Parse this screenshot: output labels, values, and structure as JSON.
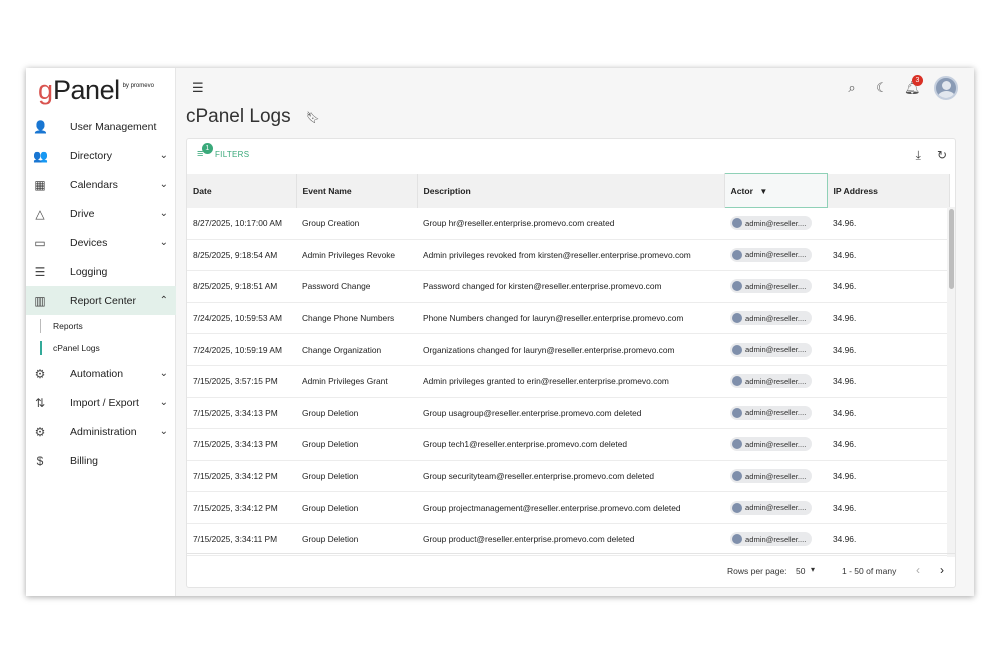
{
  "logo": {
    "g": "g",
    "rest": "Panel",
    "by": "by promevo"
  },
  "sidebar": {
    "items": [
      {
        "label": "User Management",
        "icon": "person-icon",
        "glyph": "👤",
        "chevron": ""
      },
      {
        "label": "Directory",
        "icon": "people-icon",
        "glyph": "👥",
        "chevron": "⌄"
      },
      {
        "label": "Calendars",
        "icon": "calendar-icon",
        "glyph": "▦",
        "chevron": "⌄"
      },
      {
        "label": "Drive",
        "icon": "drive-icon",
        "glyph": "△",
        "chevron": "⌄"
      },
      {
        "label": "Devices",
        "icon": "devices-icon",
        "glyph": "▭",
        "chevron": "⌄"
      },
      {
        "label": "Logging",
        "icon": "list-icon",
        "glyph": "☰",
        "chevron": ""
      },
      {
        "label": "Report Center",
        "icon": "report-icon",
        "glyph": "▥",
        "chevron": "⌃"
      },
      {
        "label": "Automation",
        "icon": "automation-icon",
        "glyph": "⚙",
        "chevron": "⌄"
      },
      {
        "label": "Import / Export",
        "icon": "import-export-icon",
        "glyph": "⇅",
        "chevron": "⌄"
      },
      {
        "label": "Administration",
        "icon": "admin-icon",
        "glyph": "⚙",
        "chevron": "⌄"
      },
      {
        "label": "Billing",
        "icon": "dollar-icon",
        "glyph": "$",
        "chevron": ""
      }
    ],
    "sub_items": [
      {
        "label": "Reports"
      },
      {
        "label": "cPanel Logs"
      }
    ]
  },
  "header": {
    "title": "cPanel Logs",
    "notification_count": "3"
  },
  "toolbar": {
    "filters_label": "FILTERS",
    "filter_count": "1"
  },
  "table": {
    "columns": [
      "Date",
      "Event Name",
      "Description",
      "Actor",
      "IP Address"
    ],
    "rows": [
      {
        "date": "8/27/2025, 10:17:00 AM",
        "event": "Group Creation",
        "desc": "Group hr@reseller.enterprise.promevo.com created",
        "actor": "admin@reseller....",
        "ip": "34.96."
      },
      {
        "date": "8/25/2025, 9:18:54 AM",
        "event": "Admin Privileges Revoke",
        "desc": "Admin privileges revoked from kirsten@reseller.enterprise.promevo.com",
        "actor": "admin@reseller....",
        "ip": "34.96."
      },
      {
        "date": "8/25/2025, 9:18:51 AM",
        "event": "Password Change",
        "desc": "Password changed for kirsten@reseller.enterprise.promevo.com",
        "actor": "admin@reseller....",
        "ip": "34.96."
      },
      {
        "date": "7/24/2025, 10:59:53 AM",
        "event": "Change Phone Numbers",
        "desc": "Phone Numbers changed for lauryn@reseller.enterprise.promevo.com",
        "actor": "admin@reseller....",
        "ip": "34.96."
      },
      {
        "date": "7/24/2025, 10:59:19 AM",
        "event": "Change Organization",
        "desc": "Organizations changed for lauryn@reseller.enterprise.promevo.com",
        "actor": "admin@reseller....",
        "ip": "34.96."
      },
      {
        "date": "7/15/2025, 3:57:15 PM",
        "event": "Admin Privileges Grant",
        "desc": "Admin privileges granted to erin@reseller.enterprise.promevo.com",
        "actor": "admin@reseller....",
        "ip": "34.96."
      },
      {
        "date": "7/15/2025, 3:34:13 PM",
        "event": "Group Deletion",
        "desc": "Group usagroup@reseller.enterprise.promevo.com deleted",
        "actor": "admin@reseller....",
        "ip": "34.96."
      },
      {
        "date": "7/15/2025, 3:34:13 PM",
        "event": "Group Deletion",
        "desc": "Group tech1@reseller.enterprise.promevo.com deleted",
        "actor": "admin@reseller....",
        "ip": "34.96."
      },
      {
        "date": "7/15/2025, 3:34:12 PM",
        "event": "Group Deletion",
        "desc": "Group securityteam@reseller.enterprise.promevo.com deleted",
        "actor": "admin@reseller....",
        "ip": "34.96."
      },
      {
        "date": "7/15/2025, 3:34:12 PM",
        "event": "Group Deletion",
        "desc": "Group projectmanagement@reseller.enterprise.promevo.com deleted",
        "actor": "admin@reseller....",
        "ip": "34.96."
      },
      {
        "date": "7/15/2025, 3:34:11 PM",
        "event": "Group Deletion",
        "desc": "Group product@reseller.enterprise.promevo.com deleted",
        "actor": "admin@reseller....",
        "ip": "34.96."
      }
    ]
  },
  "footer": {
    "rows_per_page_label": "Rows per page:",
    "rows_per_page": "50",
    "range": "1 - 50 of many"
  },
  "colors": {
    "accent": "#3aa97a",
    "brand_red": "#d9534f",
    "badge": "#d93025"
  }
}
